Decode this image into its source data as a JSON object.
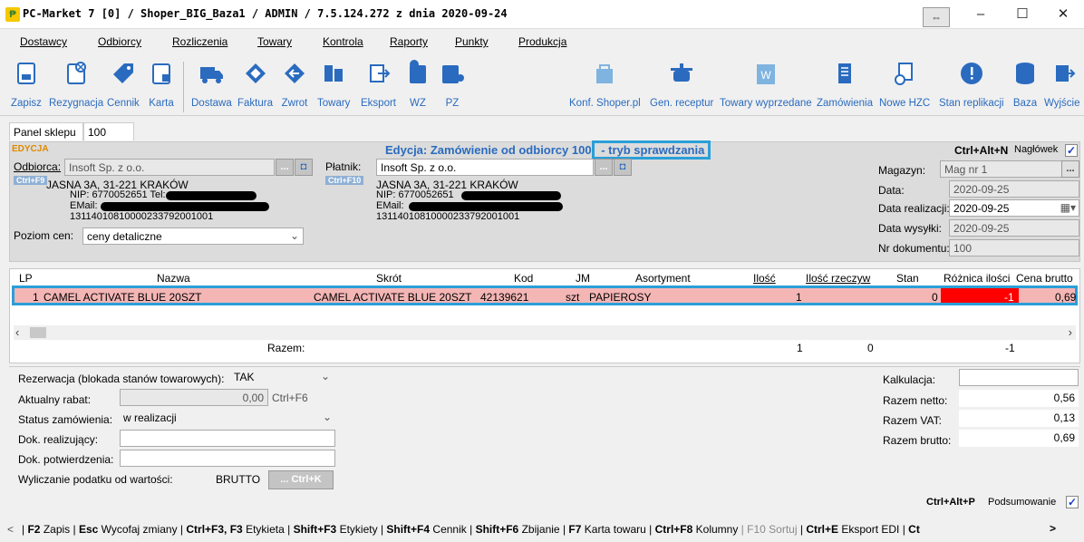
{
  "window": {
    "title": "PC-Market 7 [0] / Shoper_BIG_Baza1 / ADMIN / 7.5.124.272 z dnia 2020-09-24",
    "swap_icon": "⇔",
    "minimize": "–",
    "maximize": "☐",
    "close": "✕"
  },
  "menu": [
    "Dostawcy",
    "Odbiorcy",
    "Rozliczenia",
    "Towary",
    "Kontrola",
    "Raporty",
    "Punkty",
    "Produkcja"
  ],
  "toolbar": {
    "left": [
      "Zapisz",
      "Rezygnacja",
      "Cennik",
      "Karta"
    ],
    "mid": [
      "Dostawa",
      "Faktura",
      "Zwrot",
      "Towary",
      "Eksport",
      "WZ",
      "PZ"
    ],
    "right": [
      "Konf. Shoper.pl",
      "Gen. receptur",
      "Towary wyprzedane",
      "Zamówienia",
      "Nowe HZC",
      "Stan replikacji",
      "Baza",
      "Wyjście"
    ]
  },
  "tabs": {
    "panel": "Panel sklepu",
    "number": "100"
  },
  "header": {
    "mode": "EDYCJA",
    "title_a": "Edycja: Zamówienie od odbiorcy 100",
    "title_b": " - tryb sprawdzania",
    "shortcut": "Ctrl+Alt+N",
    "naglowek": "Nagłówek",
    "odbiorca_label": "Odbiorca:",
    "odbiorca_value": "Insoft Sp. z o.o.",
    "odbiorca_key": "Ctrl+F9",
    "odbiorca_addr": "JASNA 3A, 31-221 KRAKÓW",
    "odbiorca_nip": "NIP: 6770052651 Tel:",
    "odbiorca_email": "EMail:",
    "odbiorca_acct": "13114010810000233792001001",
    "platnik_label": "Płatnik:",
    "platnik_value": "Insoft Sp. z o.o.",
    "platnik_key": "Ctrl+F10",
    "platnik_addr": "JASNA 3A, 31-221 KRAKÓW",
    "platnik_nip": "NIP: 6770052651",
    "platnik_email": "EMail:",
    "platnik_acct": "13114010810000233792001001",
    "poziom_label": "Poziom cen:",
    "poziom_value": "ceny detaliczne",
    "magazyn_label": "Magazyn:",
    "magazyn_value": "Mag nr 1",
    "data_label": "Data:",
    "data_value": "2020-09-25",
    "realizacja_label": "Data realizacji:",
    "realizacja_value": "2020-09-25",
    "wysylki_label": "Data wysyłki:",
    "wysylki_value": "2020-09-25",
    "nrdok_label": "Nr dokumentu:",
    "nrdok_value": "100",
    "dots": "..."
  },
  "grid": {
    "headers": [
      "LP",
      "Nazwa",
      "Skrót",
      "Kod",
      "JM",
      "Asortyment",
      "Ilość",
      "Ilość rzeczyw",
      "Stan",
      "Różnica ilości",
      "Cena brutto"
    ],
    "row": {
      "lp": "1",
      "nazwa": "CAMEL ACTIVATE BLUE 20SZT",
      "skrot": "CAMEL ACTIVATE BLUE 20SZT",
      "kod": "42139621",
      "jm": "szt",
      "asortyment": "PAPIEROSY",
      "ilosc": "1",
      "stan": "0",
      "roznica": "-1",
      "cena": "0,69"
    },
    "razem_label": "Razem:",
    "razem_ilosc": "1",
    "razem_rzecz": "0",
    "razem_roznica": "-1"
  },
  "footer": {
    "rezerwacja_label": "Rezerwacja (blokada stanów towarowych):",
    "rezerwacja_value": "TAK",
    "rabat_label": "Aktualny rabat:",
    "rabat_value": "0,00",
    "rabat_key": "Ctrl+F6",
    "status_label": "Status zamówienia:",
    "status_value": "w realizacji",
    "dok_real_label": "Dok. realizujący:",
    "dok_potw_label": "Dok. potwierdzenia:",
    "podatek_label": "Wyliczanie podatku od wartości:",
    "podatek_value": "BRUTTO",
    "podatek_key": "... Ctrl+K",
    "kalkulacja_label": "Kalkulacja:",
    "netto_label": "Razem netto:",
    "netto_value": "0,56",
    "vat_label": "Razem VAT:",
    "vat_value": "0,13",
    "brutto_label": "Razem brutto:",
    "brutto_value": "0,69",
    "summary_key": "Ctrl+Alt+P",
    "summary_label": "Podsumowanie"
  },
  "statusbar": [
    {
      "key": "F2",
      "label": "Zapis"
    },
    {
      "key": "Esc",
      "label": "Wycofaj zmiany"
    },
    {
      "key": "Ctrl+F3, F3",
      "label": "Etykieta"
    },
    {
      "key": "Shift+F3",
      "label": "Etykiety"
    },
    {
      "key": "Shift+F4",
      "label": "Cennik"
    },
    {
      "key": "Shift+F6",
      "label": "Zbijanie"
    },
    {
      "key": "F7",
      "label": "Karta towaru"
    },
    {
      "key": "Ctrl+F8",
      "label": "Kolumny"
    },
    {
      "key": "F10",
      "label": "Sortuj"
    },
    {
      "key": "Ctrl+E",
      "label": "Eksport EDI"
    },
    {
      "key": "Ct",
      "label": ""
    }
  ],
  "colors": {
    "accent": "#2a6bbf",
    "highlight_box": "#2a9fd8",
    "row_bg": "#f4b5b5",
    "diff_red": "#ff0000"
  }
}
